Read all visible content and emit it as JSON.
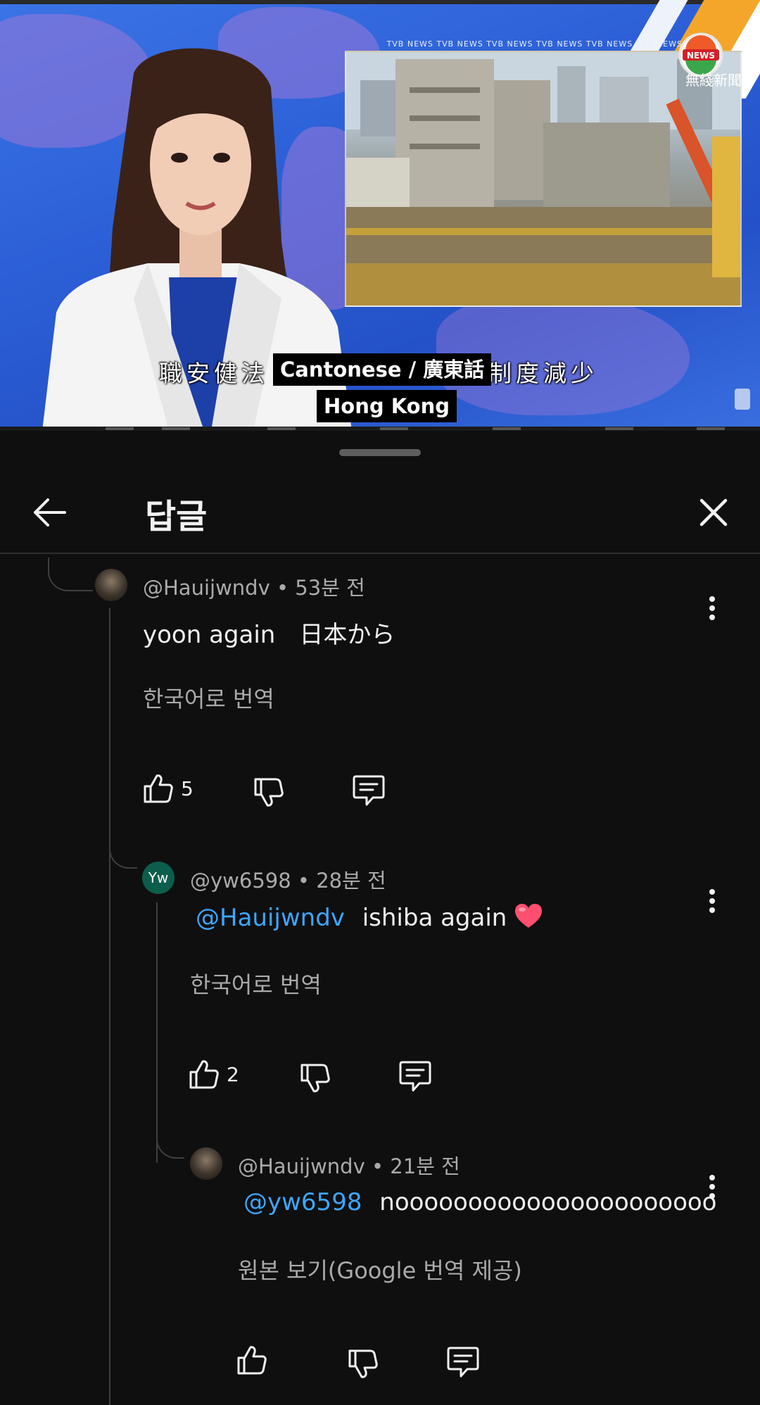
{
  "video": {
    "ticker": "TVB NEWS    TVB NEWS    TVB NEWS    TVB NEWS    TVB NEWS    TVB NEWS",
    "logo_badge": "NEWS",
    "logo_caption": "無綫新聞",
    "subtitle_left": "職安健法",
    "subtitle_right": "制度減少",
    "caption_language": "Cantonese / 廣東話",
    "caption_region": "Hong Kong"
  },
  "sheet": {
    "title": "답글"
  },
  "comments": [
    {
      "author": "@Hauijwndv",
      "age": "53분 전",
      "text": "yoon again　日本から",
      "translate_label": "한국어로 번역",
      "likes": "5"
    },
    {
      "avatar_initials": "Yw",
      "author": "@yw6598",
      "age": "28분 전",
      "mention": "@Hauijwndv",
      "text": "ishiba again",
      "translate_label": "한국어로 번역",
      "likes": "2"
    },
    {
      "author": "@Hauijwndv",
      "age": "21분 전",
      "mention": "@yw6598",
      "text": "noooooooooooooooooooooo",
      "translate_label": "원본 보기(Google 번역 제공)",
      "likes": ""
    }
  ],
  "icons": {
    "back": "arrow-left-icon",
    "close": "close-icon",
    "more": "more-vert-icon",
    "like": "thumb-up-icon",
    "dislike": "thumb-down-icon",
    "reply": "reply-icon",
    "heart": "heart-emoji"
  },
  "colors": {
    "background": "#0f0f0f",
    "mention": "#3ea6ff",
    "secondary_text": "#aaaaaa",
    "avatar_yw": "#0b5e4c"
  }
}
